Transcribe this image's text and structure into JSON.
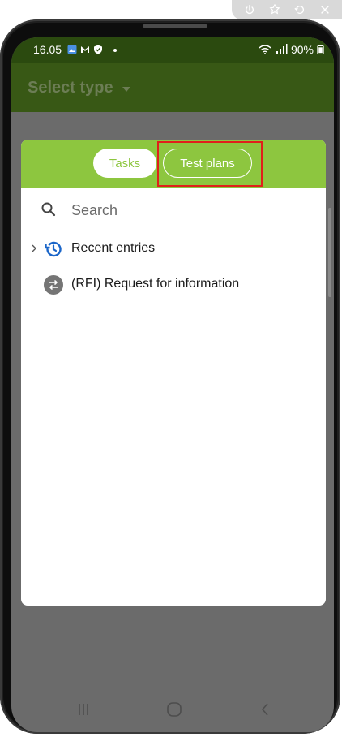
{
  "emulator_toolbar": {
    "icons": [
      "power-icon",
      "pin-icon",
      "rotate-icon",
      "close-icon"
    ]
  },
  "status_bar": {
    "time": "16.05",
    "left_icons": [
      "gallery-icon",
      "gmail-icon",
      "shield-icon"
    ],
    "battery": "90%",
    "right_icons": [
      "wifi-icon",
      "signal-icon",
      "battery-icon"
    ]
  },
  "app_bar": {
    "title": "Select type",
    "caret_icon": "caret-down-icon"
  },
  "dialog": {
    "tabs": [
      {
        "label": "Tasks",
        "selected": true
      },
      {
        "label": "Test plans",
        "selected": false
      }
    ],
    "search": {
      "placeholder": "Search",
      "value": ""
    },
    "items": [
      {
        "label": "Recent entries",
        "icon": "history-icon",
        "expandable": true
      },
      {
        "label": "(RFI) Request for information",
        "icon": "swap-icon",
        "expandable": false
      }
    ]
  },
  "nav_bar": {
    "icons": [
      "recents-icon",
      "home-icon",
      "back-icon"
    ]
  },
  "colors": {
    "status_bar": "#2b4a0f",
    "accent_green": "#8dc63f",
    "highlight": "#e0201a",
    "dim": "#6b6b6b"
  }
}
